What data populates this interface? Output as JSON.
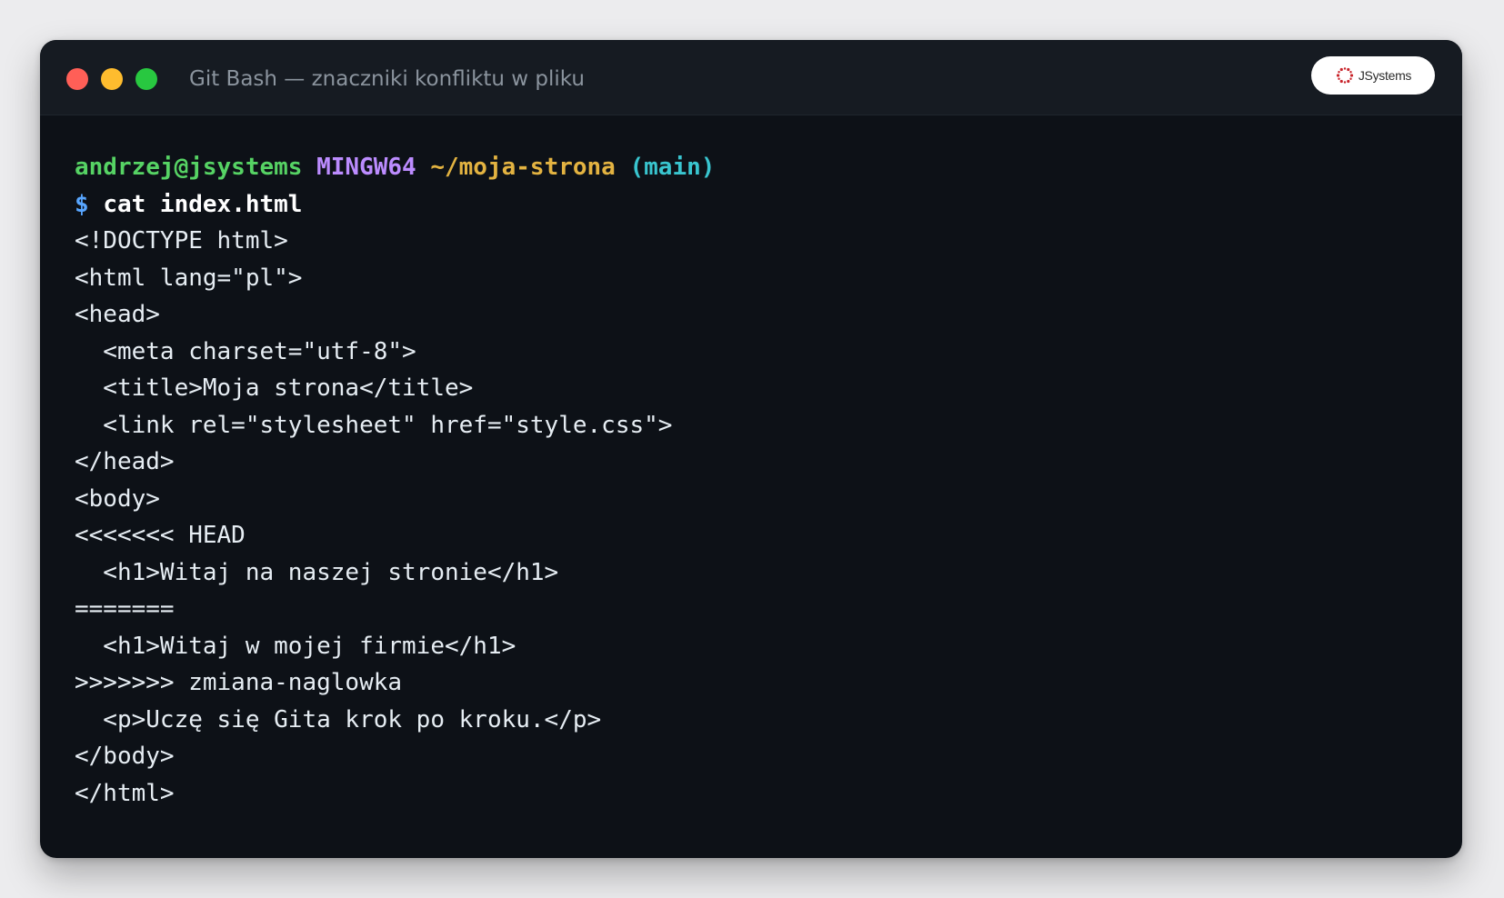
{
  "window": {
    "title": "Git Bash — znaczniki konfliktu w pliku",
    "controls": [
      {
        "name": "close",
        "color": "#ff5f57"
      },
      {
        "name": "minimize",
        "color": "#febc2e"
      },
      {
        "name": "maximize",
        "color": "#28c840"
      }
    ],
    "logo": {
      "icon": "jsystems-logo-icon",
      "text": "JSystems",
      "color": "#c9252c"
    }
  },
  "prompt": {
    "user": "andrzej@jsystems",
    "system": "MINGW64",
    "path": "~/moja-strona",
    "branch": "(main)",
    "symbol": "$",
    "command": "cat index.html"
  },
  "output_lines": [
    "<!DOCTYPE html>",
    "<html lang=\"pl\">",
    "<head>",
    "  <meta charset=\"utf-8\">",
    "  <title>Moja strona</title>",
    "  <link rel=\"stylesheet\" href=\"style.css\">",
    "</head>",
    "<body>",
    "<<<<<<< HEAD",
    "  <h1>Witaj na naszej stronie</h1>",
    "=======",
    "  <h1>Witaj w mojej firmie</h1>",
    ">>>>>>> zmiana-naglowka",
    "  <p>Uczę się Gita krok po kroku.</p>",
    "</body>",
    "</html>"
  ],
  "colors": {
    "background": "#0d1117",
    "titlebar": "#161b22",
    "text": "#e6edf3",
    "user": "#56d364",
    "system": "#bc8cff",
    "path": "#e3b341",
    "branch": "#39c5cf",
    "dollar": "#58a6ff"
  }
}
